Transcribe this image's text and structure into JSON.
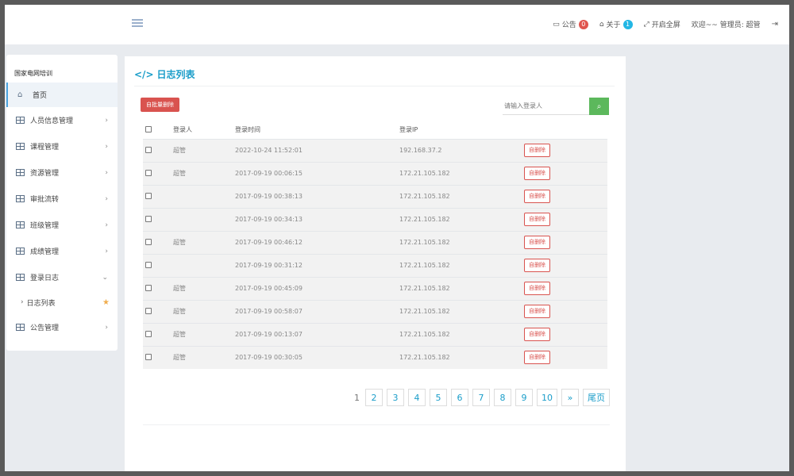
{
  "topbar": {
    "notice_label": "公告",
    "notice_count": "0",
    "about_label": "关于",
    "about_count": "1",
    "fullscreen_label": "开启全屏",
    "welcome": "欢迎~~ 管理员: 超管"
  },
  "sidebar": {
    "brand": "国家电网培训",
    "items": [
      {
        "label": "首页"
      },
      {
        "label": "人员信息管理"
      },
      {
        "label": "课程管理"
      },
      {
        "label": "资源管理"
      },
      {
        "label": "审批流转"
      },
      {
        "label": "班级管理"
      },
      {
        "label": "成绩管理"
      },
      {
        "label": "登录日志"
      },
      {
        "label": "日志列表"
      },
      {
        "label": "公告管理"
      }
    ]
  },
  "main": {
    "title": "日志列表",
    "batch_delete": "自批量删除",
    "search_placeholder": "请输入登录人",
    "columns": [
      "登录人",
      "登录时间",
      "登录IP"
    ],
    "delete_label": "自删除",
    "rows": [
      {
        "user": "超管",
        "time": "2022-10-24 11:52:01",
        "ip": "192.168.37.2"
      },
      {
        "user": "超管",
        "time": "2017-09-19 00:06:15",
        "ip": "172.21.105.182"
      },
      {
        "user": "",
        "time": "2017-09-19 00:38:13",
        "ip": "172.21.105.182"
      },
      {
        "user": "",
        "time": "2017-09-19 00:34:13",
        "ip": "172.21.105.182"
      },
      {
        "user": "超管",
        "time": "2017-09-19 00:46:12",
        "ip": "172.21.105.182"
      },
      {
        "user": "",
        "time": "2017-09-19 00:31:12",
        "ip": "172.21.105.182"
      },
      {
        "user": "超管",
        "time": "2017-09-19 00:45:09",
        "ip": "172.21.105.182"
      },
      {
        "user": "超管",
        "time": "2017-09-19 00:58:07",
        "ip": "172.21.105.182"
      },
      {
        "user": "超管",
        "time": "2017-09-19 00:13:07",
        "ip": "172.21.105.182"
      },
      {
        "user": "超管",
        "time": "2017-09-19 00:30:05",
        "ip": "172.21.105.182"
      }
    ],
    "pagination": {
      "current": "1",
      "pages": [
        "2",
        "3",
        "4",
        "5",
        "6",
        "7",
        "8",
        "9",
        "10"
      ],
      "next": "»",
      "last": "尾页"
    }
  }
}
